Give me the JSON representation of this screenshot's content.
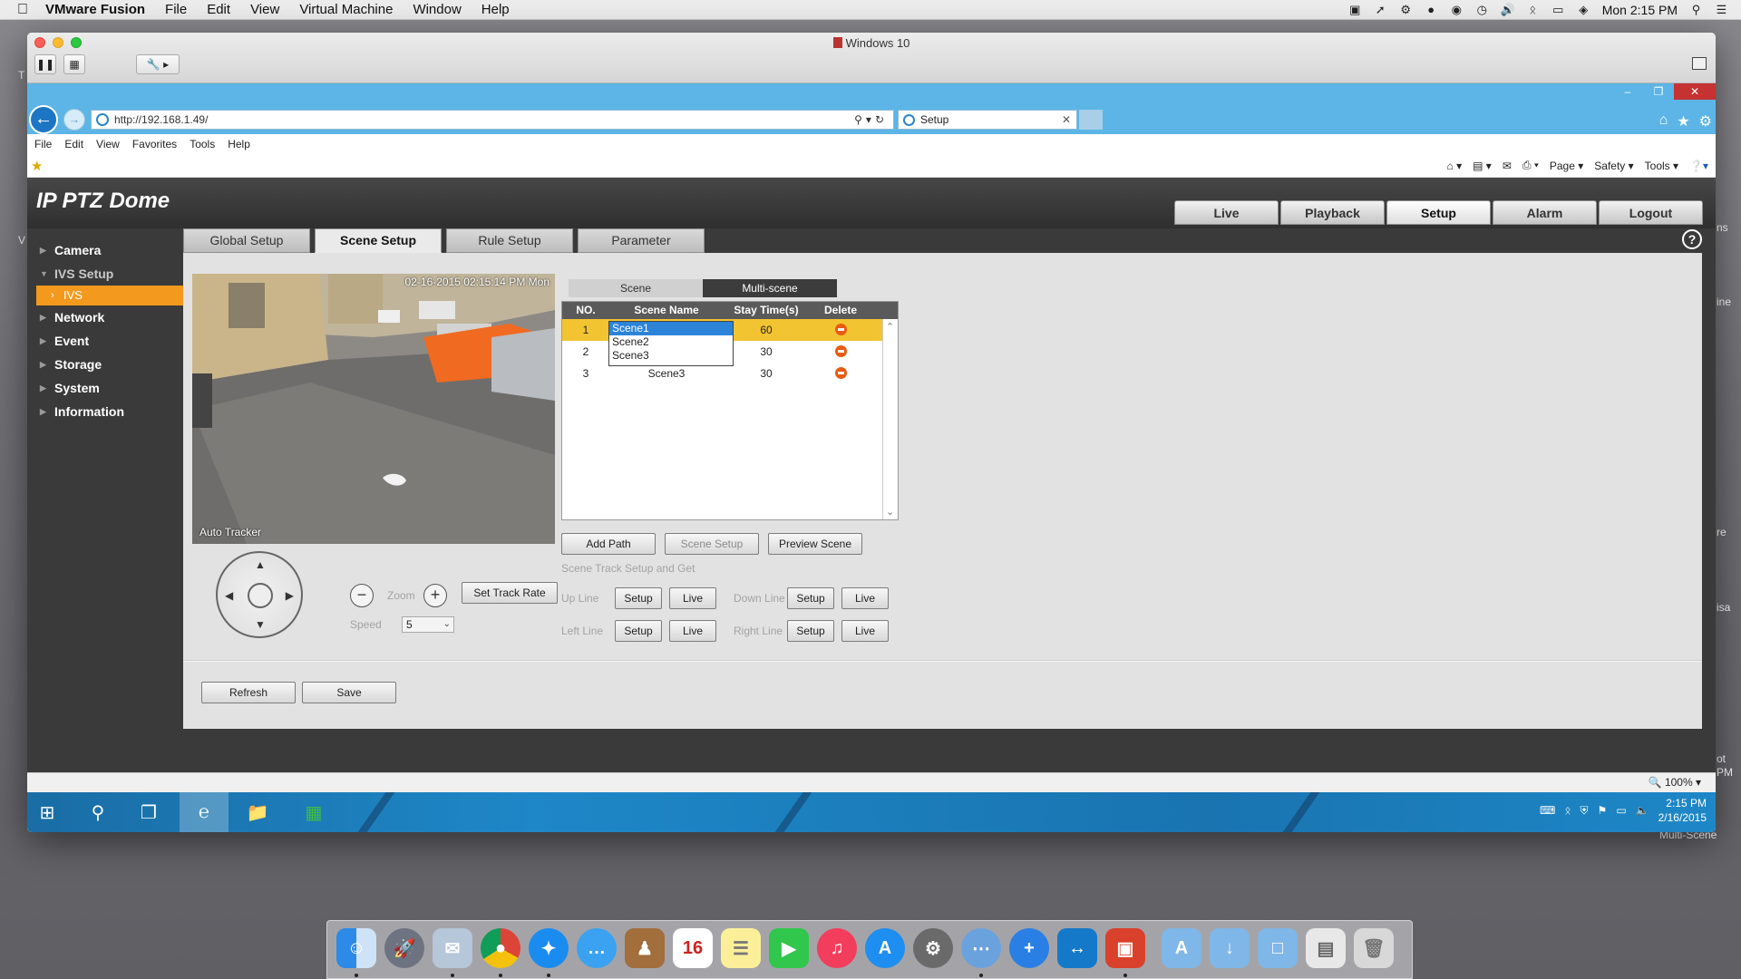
{
  "mac": {
    "app_name": "VMware Fusion",
    "menus": [
      "File",
      "Edit",
      "View",
      "Virtual Machine",
      "Window",
      "Help"
    ],
    "clock": "Mon 2:15 PM"
  },
  "desktop_labels": {
    "left1": "T",
    "left2": "V",
    "r1": "ns",
    "r2": "ine",
    "r3": "re",
    "r4": "isa",
    "r5": "ot\nPM",
    "r6": "Multi-Scene"
  },
  "vm": {
    "title": "Windows 10"
  },
  "ie": {
    "url": "http://192.168.1.49/",
    "tab_title": "Setup",
    "menus": [
      "File",
      "Edit",
      "View",
      "Favorites",
      "Tools",
      "Help"
    ],
    "cmd": {
      "page": "Page",
      "safety": "Safety",
      "tools": "Tools"
    },
    "zoom": "100%"
  },
  "camera": {
    "brand": "IP PTZ Dome",
    "nav": [
      "Live",
      "Playback",
      "Setup",
      "Alarm",
      "Logout"
    ],
    "nav_active": "Setup",
    "sidebar": {
      "camera": "Camera",
      "ivs_setup": "IVS Setup",
      "ivs": "IVS",
      "network": "Network",
      "event": "Event",
      "storage": "Storage",
      "system": "System",
      "information": "Information"
    },
    "tabs": [
      "Global Setup",
      "Scene Setup",
      "Rule Setup",
      "Parameter"
    ],
    "help": "?",
    "video": {
      "timestamp": "02-16-2015 02:15:14 PM Mon",
      "tracker": "Auto Tracker"
    },
    "scene_tabs": {
      "scene": "Scene",
      "multi": "Multi-scene"
    },
    "table": {
      "headers": [
        "NO.",
        "Scene Name",
        "Stay Time(s)",
        "Delete"
      ],
      "rows": [
        {
          "no": "1",
          "name": "",
          "stay": "60"
        },
        {
          "no": "2",
          "name": "",
          "stay": "30"
        },
        {
          "no": "3",
          "name": "Scene3",
          "stay": "30"
        }
      ]
    },
    "dropdown_options": [
      "Scene1",
      "Scene2",
      "Scene3"
    ],
    "buttons": {
      "add_path": "Add Path",
      "scene_setup": "Scene Setup",
      "preview_scene": "Preview Scene",
      "set_track_rate": "Set Track Rate",
      "refresh": "Refresh",
      "save": "Save",
      "setup": "Setup",
      "live": "Live"
    },
    "ptz": {
      "zoom_label": "Zoom",
      "speed_label": "Speed",
      "speed_value": "5",
      "minus": "−",
      "plus": "+"
    },
    "track": {
      "title": "Scene Track Setup and Get",
      "up_line": "Up Line",
      "down_line": "Down Line",
      "left_line": "Left Line",
      "right_line": "Right Line"
    }
  },
  "win": {
    "clock_time": "2:15 PM",
    "clock_date": "2/16/2015"
  }
}
